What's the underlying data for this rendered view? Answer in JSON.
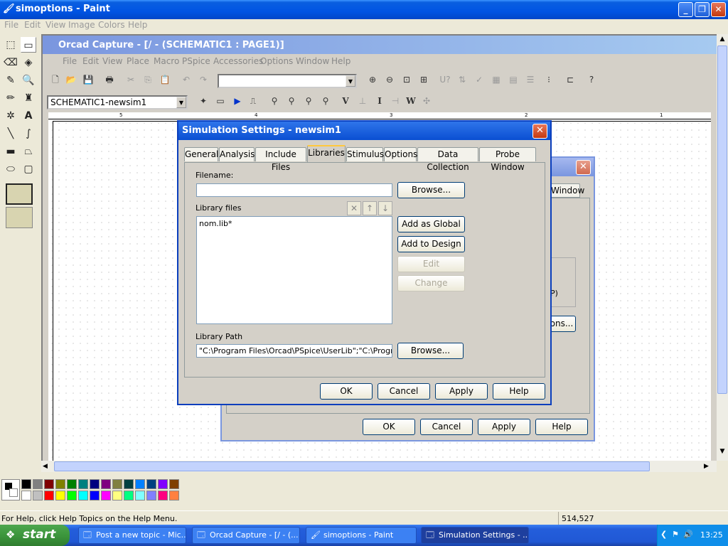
{
  "paint": {
    "title": "simoptions - Paint",
    "menu": [
      "File",
      "Edit",
      "View",
      "Image",
      "Colors",
      "Help"
    ],
    "status": "For Help, click Help Topics on the Help Menu.",
    "coords": "514,527",
    "colors": [
      "#000000",
      "#808080",
      "#800000",
      "#808000",
      "#008000",
      "#008080",
      "#000080",
      "#800080",
      "#808040",
      "#004040",
      "#0080ff",
      "#004080",
      "#8000ff",
      "#804000",
      "#ffffff",
      "#c0c0c0",
      "#ff0000",
      "#ffff00",
      "#00ff00",
      "#00ffff",
      "#0000ff",
      "#ff00ff",
      "#ffff80",
      "#00ff80",
      "#80ffff",
      "#8080ff",
      "#ff0080",
      "#ff8040"
    ]
  },
  "orcad": {
    "title": "Orcad Capture - [/ - (SCHEMATIC1 : PAGE1)]",
    "menu": [
      "File",
      "Edit",
      "View",
      "Place",
      "Macro",
      "PSpice",
      "Accessories",
      "Options",
      "Window",
      "Help"
    ],
    "profile": "SCHEMATIC1-newsim1",
    "ruler": [
      "5",
      "4",
      "3",
      "2",
      "1"
    ]
  },
  "back_dialog": {
    "tab_partial": "Window",
    "partial1": "P)",
    "partial2": "ons...",
    "ok": "OK",
    "cancel": "Cancel",
    "apply": "Apply",
    "help": "Help"
  },
  "dialog": {
    "title": "Simulation Settings - newsim1",
    "tabs": [
      "General",
      "Analysis",
      "Include Files",
      "Libraries",
      "Stimulus",
      "Options",
      "Data Collection",
      "Probe Window"
    ],
    "active_tab": "Libraries",
    "filename_label": "Filename:",
    "filename_value": "",
    "browse": "Browse...",
    "library_files_label": "Library files",
    "library_files": [
      "nom.lib*"
    ],
    "add_global": "Add as Global",
    "add_design": "Add to Design",
    "edit": "Edit",
    "change": "Change",
    "library_path_label": "Library Path",
    "library_path_value": "\"C:\\Program Files\\Orcad\\PSpice\\UserLib\";\"C:\\Program F",
    "browse2": "Browse...",
    "ok": "OK",
    "cancel": "Cancel",
    "apply": "Apply",
    "help": "Help"
  },
  "taskbar": {
    "start": "start",
    "tasks": [
      "Post a new topic - Mic...",
      "Orcad Capture - [/ - (...",
      "simoptions - Paint",
      "Simulation Settings - ..."
    ],
    "time": "13:25"
  }
}
